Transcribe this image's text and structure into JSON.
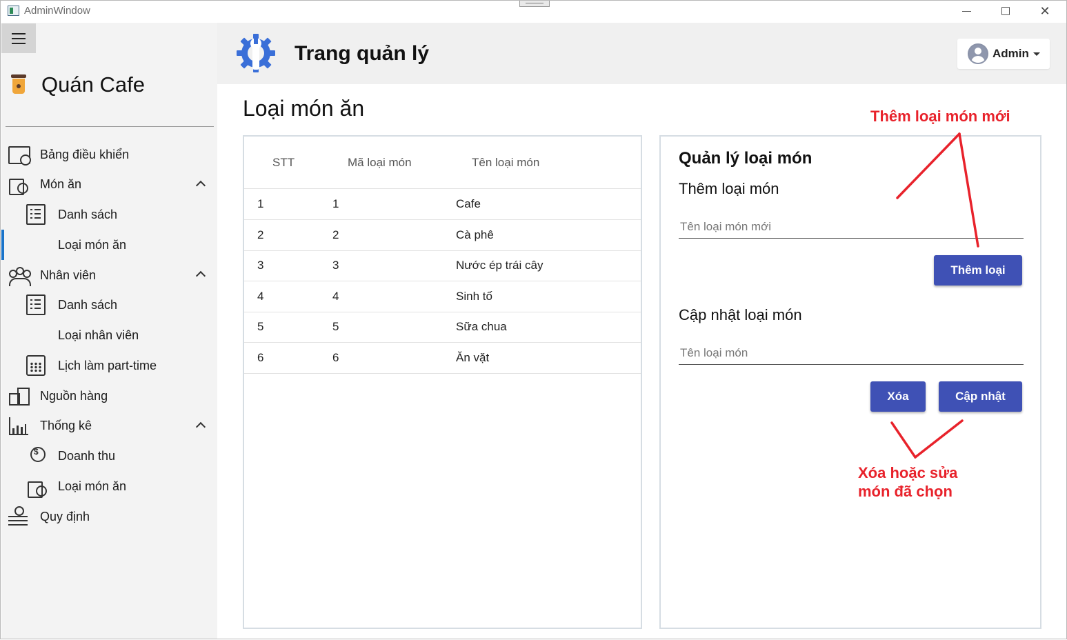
{
  "window": {
    "title": "AdminWindow",
    "controls": {
      "minimize": "minimize-icon",
      "maximize": "maximize-icon",
      "close": "close-icon"
    }
  },
  "sidebar": {
    "brand": "Quán Cafe",
    "items": [
      {
        "label": "Bảng điều khiển",
        "icon": "dashboard-icon"
      },
      {
        "label": "Món ăn",
        "icon": "food-icon",
        "expanded": true
      },
      {
        "label": "Danh sách",
        "icon": "list-icon"
      },
      {
        "label": "Loại món ăn",
        "icon": "grid-icon",
        "active": true
      },
      {
        "label": "Nhân viên",
        "icon": "people-icon",
        "expanded": true
      },
      {
        "label": "Danh sách",
        "icon": "list-icon"
      },
      {
        "label": "Loại nhân viên",
        "icon": "grid-icon"
      },
      {
        "label": "Lịch làm part-time",
        "icon": "calendar-icon"
      },
      {
        "label": "Nguồn hàng",
        "icon": "boxes-icon"
      },
      {
        "label": "Thống kê",
        "icon": "chart-icon",
        "expanded": true
      },
      {
        "label": "Doanh thu",
        "icon": "revenue-icon"
      },
      {
        "label": "Loại món ăn",
        "icon": "food-type-icon"
      },
      {
        "label": "Quy định",
        "icon": "settings-icon"
      }
    ]
  },
  "header": {
    "title": "Trang quản lý",
    "user": "Admin"
  },
  "page": {
    "title": "Loại món ăn"
  },
  "table": {
    "columns": [
      "STT",
      "Mã loại món",
      "Tên loại món"
    ],
    "rows": [
      [
        "1",
        "1",
        "Cafe"
      ],
      [
        "2",
        "2",
        "Cà phê"
      ],
      [
        "3",
        "3",
        "Nước ép trái cây"
      ],
      [
        "4",
        "4",
        "Sinh tố"
      ],
      [
        "5",
        "5",
        "Sữa chua"
      ],
      [
        "6",
        "6",
        "Ăn vặt"
      ]
    ]
  },
  "form": {
    "heading": "Quản lý loại món",
    "add_section": "Thêm loại món",
    "add_placeholder": "Tên loại món mới",
    "add_button": "Thêm loại",
    "update_section": "Cập nhật loại món",
    "update_placeholder": "Tên loại món",
    "delete_button": "Xóa",
    "update_button": "Cập nhật"
  },
  "annotations": {
    "add_note": "Thêm loại món mới",
    "edit_note_line1": "Xóa hoặc sửa",
    "edit_note_line2": "món đã chọn",
    "color": "#e8222b"
  },
  "colors": {
    "primary_button": "#3f51b5",
    "logo_blue": "#3a6fd8",
    "active_indicator": "#1a73c9"
  }
}
